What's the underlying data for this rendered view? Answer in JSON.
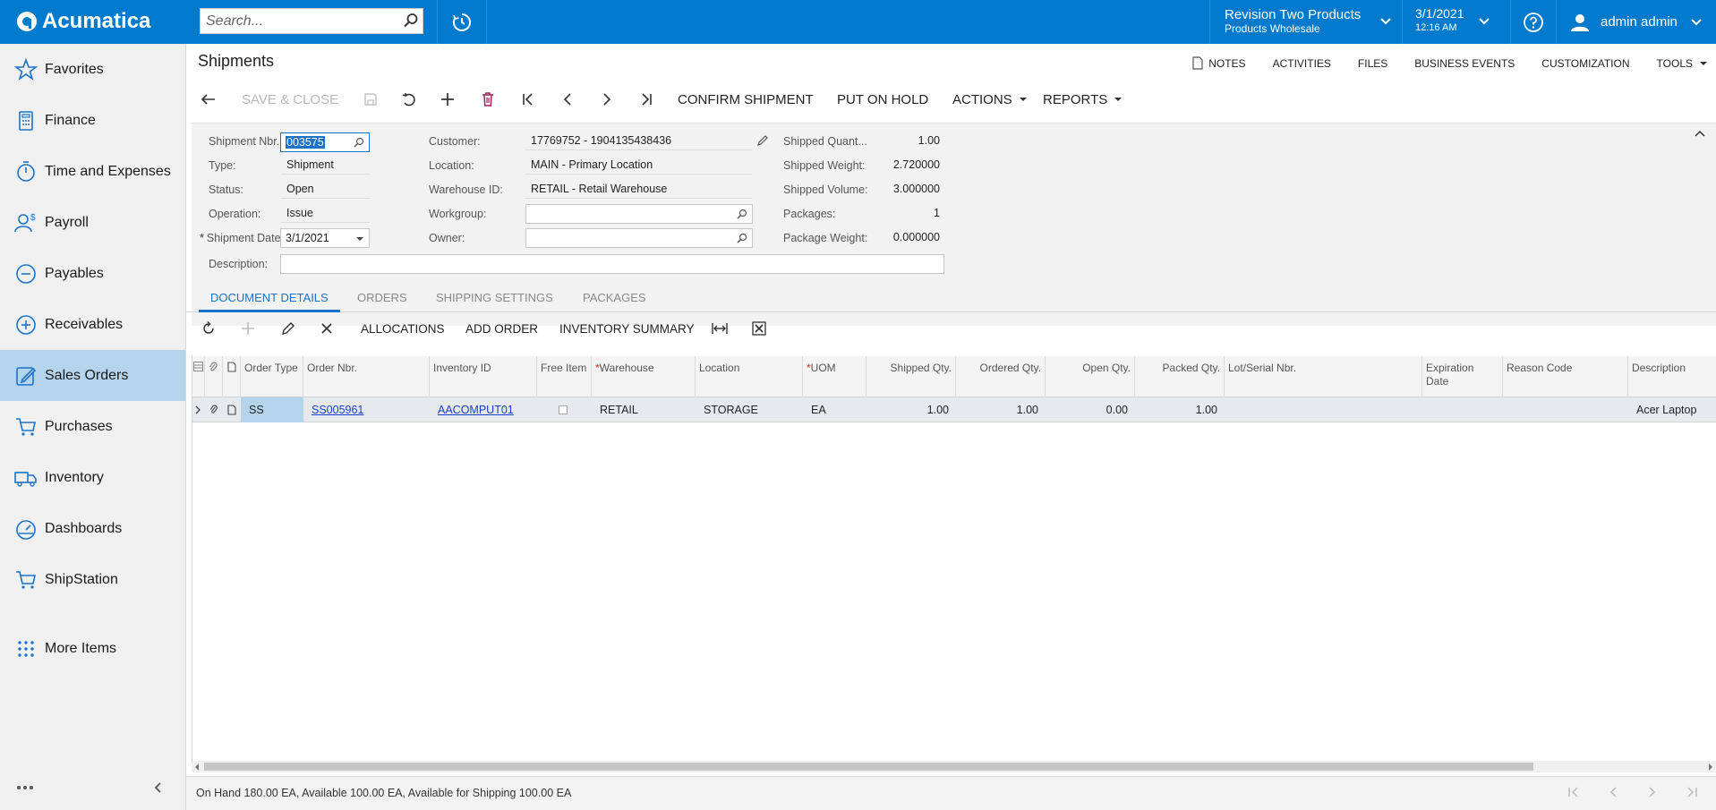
{
  "app": {
    "brand": "Acumatica",
    "accent": "#007acc"
  },
  "topbar": {
    "search_placeholder": "Search...",
    "company_name": "Revision Two Products",
    "company_branch": "Products Wholesale",
    "date": "3/1/2021",
    "time": "12:16 AM",
    "user": "admin admin"
  },
  "sidebar": {
    "items": [
      {
        "label": "Favorites",
        "icon": "star-icon"
      },
      {
        "label": "Finance",
        "icon": "calculator-icon"
      },
      {
        "label": "Time and Expenses",
        "icon": "stopwatch-icon"
      },
      {
        "label": "Payroll",
        "icon": "person-dollar-icon"
      },
      {
        "label": "Payables",
        "icon": "minus-circle-icon"
      },
      {
        "label": "Receivables",
        "icon": "plus-circle-icon"
      },
      {
        "label": "Sales Orders",
        "icon": "pencil-edit-icon",
        "active": true
      },
      {
        "label": "Purchases",
        "icon": "cart-icon"
      },
      {
        "label": "Inventory",
        "icon": "truck-icon"
      },
      {
        "label": "Dashboards",
        "icon": "gauge-icon"
      },
      {
        "label": "ShipStation",
        "icon": "cart-icon"
      },
      {
        "label": "More Items",
        "icon": "grid-dots-icon"
      }
    ]
  },
  "page": {
    "title": "Shipments",
    "links": [
      "NOTES",
      "ACTIVITIES",
      "FILES",
      "BUSINESS EVENTS",
      "CUSTOMIZATION",
      "TOOLS"
    ]
  },
  "toolbar": {
    "save_close": "SAVE & CLOSE",
    "confirm_shipment": "CONFIRM SHIPMENT",
    "put_on_hold": "PUT ON HOLD",
    "actions": "ACTIONS",
    "reports": "REPORTS"
  },
  "form": {
    "shipment_nbr_label": "Shipment Nbr.:",
    "shipment_nbr": "003575",
    "type_label": "Type:",
    "type": "Shipment",
    "status_label": "Status:",
    "status": "Open",
    "operation_label": "Operation:",
    "operation": "Issue",
    "shipment_date_label": "Shipment Date:",
    "shipment_date": "3/1/2021",
    "description_label": "Description:",
    "description": "",
    "customer_label": "Customer:",
    "customer": "17769752 - 1904135438436",
    "location_label": "Location:",
    "location": "MAIN - Primary Location",
    "warehouse_label": "Warehouse ID:",
    "warehouse": "RETAIL - Retail Warehouse",
    "workgroup_label": "Workgroup:",
    "workgroup": "",
    "owner_label": "Owner:",
    "owner": "",
    "shipped_qty_label": "Shipped Quant...",
    "shipped_qty": "1.00",
    "shipped_weight_label": "Shipped Weight:",
    "shipped_weight": "2.720000",
    "shipped_volume_label": "Shipped Volume:",
    "shipped_volume": "3.000000",
    "packages_label": "Packages:",
    "packages": "1",
    "package_weight_label": "Package Weight:",
    "package_weight": "0.000000"
  },
  "tabs": [
    "DOCUMENT DETAILS",
    "ORDERS",
    "SHIPPING SETTINGS",
    "PACKAGES"
  ],
  "grid_toolbar": {
    "allocations": "ALLOCATIONS",
    "add_order": "ADD ORDER",
    "inventory_summary": "INVENTORY SUMMARY"
  },
  "grid": {
    "columns": {
      "order_type": "Order Type",
      "order_nbr": "Order Nbr.",
      "inventory_id": "Inventory ID",
      "free_item": "Free Item",
      "warehouse": "Warehouse",
      "location": "Location",
      "uom": "UOM",
      "shipped_qty": "Shipped Qty.",
      "ordered_qty": "Ordered Qty.",
      "open_qty": "Open Qty.",
      "packed_qty": "Packed Qty.",
      "lot_serial": "Lot/Serial Nbr.",
      "expiration_date": "Expiration Date",
      "reason_code": "Reason Code",
      "description": "Description"
    },
    "rows": [
      {
        "order_type": "SS",
        "order_nbr": "SS005961",
        "inventory_id": "AACOMPUT01",
        "free_item": false,
        "warehouse": "RETAIL",
        "location": "STORAGE",
        "uom": "EA",
        "shipped_qty": "1.00",
        "ordered_qty": "1.00",
        "open_qty": "0.00",
        "packed_qty": "1.00",
        "lot_serial": "",
        "expiration_date": "",
        "reason_code": "",
        "description": "Acer Laptop"
      }
    ]
  },
  "status_bar": "On Hand 180.00 EA, Available 100.00 EA, Available for Shipping 100.00 EA"
}
